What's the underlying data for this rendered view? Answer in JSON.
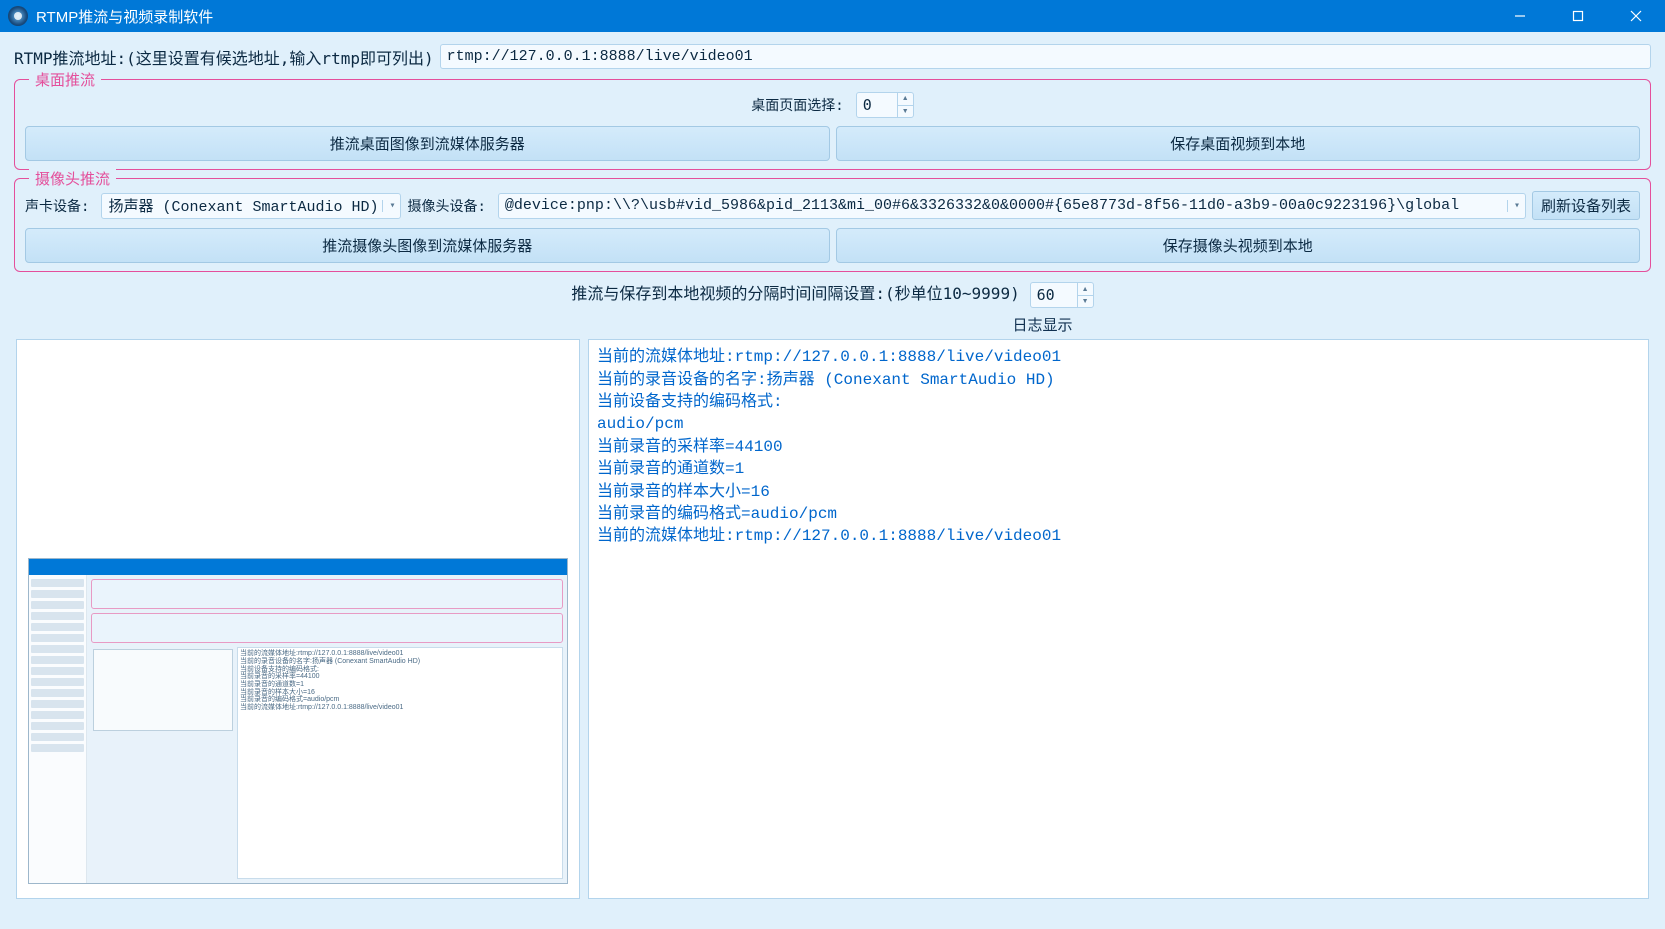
{
  "window": {
    "title": "RTMP推流与视频录制软件"
  },
  "rtmp": {
    "label": "RTMP推流地址:(这里设置有候选地址,输入rtmp即可列出)",
    "value": "rtmp://127.0.0.1:8888/live/video01"
  },
  "desktop_group": {
    "title": "桌面推流",
    "page_label": "桌面页面选择:",
    "page_value": "0",
    "push_button": "推流桌面图像到流媒体服务器",
    "save_button": "保存桌面视频到本地"
  },
  "camera_group": {
    "title": "摄像头推流",
    "audio_label": "声卡设备:",
    "audio_value": "扬声器 (Conexant SmartAudio HD)",
    "camera_label": "摄像头设备:",
    "camera_value": "@device:pnp:\\\\?\\usb#vid_5986&pid_2113&mi_00#6&3326332&0&0000#{65e8773d-8f56-11d0-a3b9-00a0c9223196}\\global",
    "refresh_button": "刷新设备列表",
    "push_button": "推流摄像头图像到流媒体服务器",
    "save_button": "保存摄像头视频到本地"
  },
  "interval": {
    "label": "推流与保存到本地视频的分隔时间间隔设置:(秒单位10~9999)",
    "value": "60"
  },
  "log_title": "日志显示",
  "log_lines": [
    "当前的流媒体地址:rtmp://127.0.0.1:8888/live/video01",
    "当前的录音设备的名字:扬声器 (Conexant SmartAudio HD)",
    "当前设备支持的编码格式:",
    "audio/pcm",
    "当前录音的采样率=44100",
    "当前录音的通道数=1",
    "当前录音的样本大小=16",
    "当前录音的编码格式=audio/pcm",
    "当前的流媒体地址:rtmp://127.0.0.1:8888/live/video01"
  ]
}
